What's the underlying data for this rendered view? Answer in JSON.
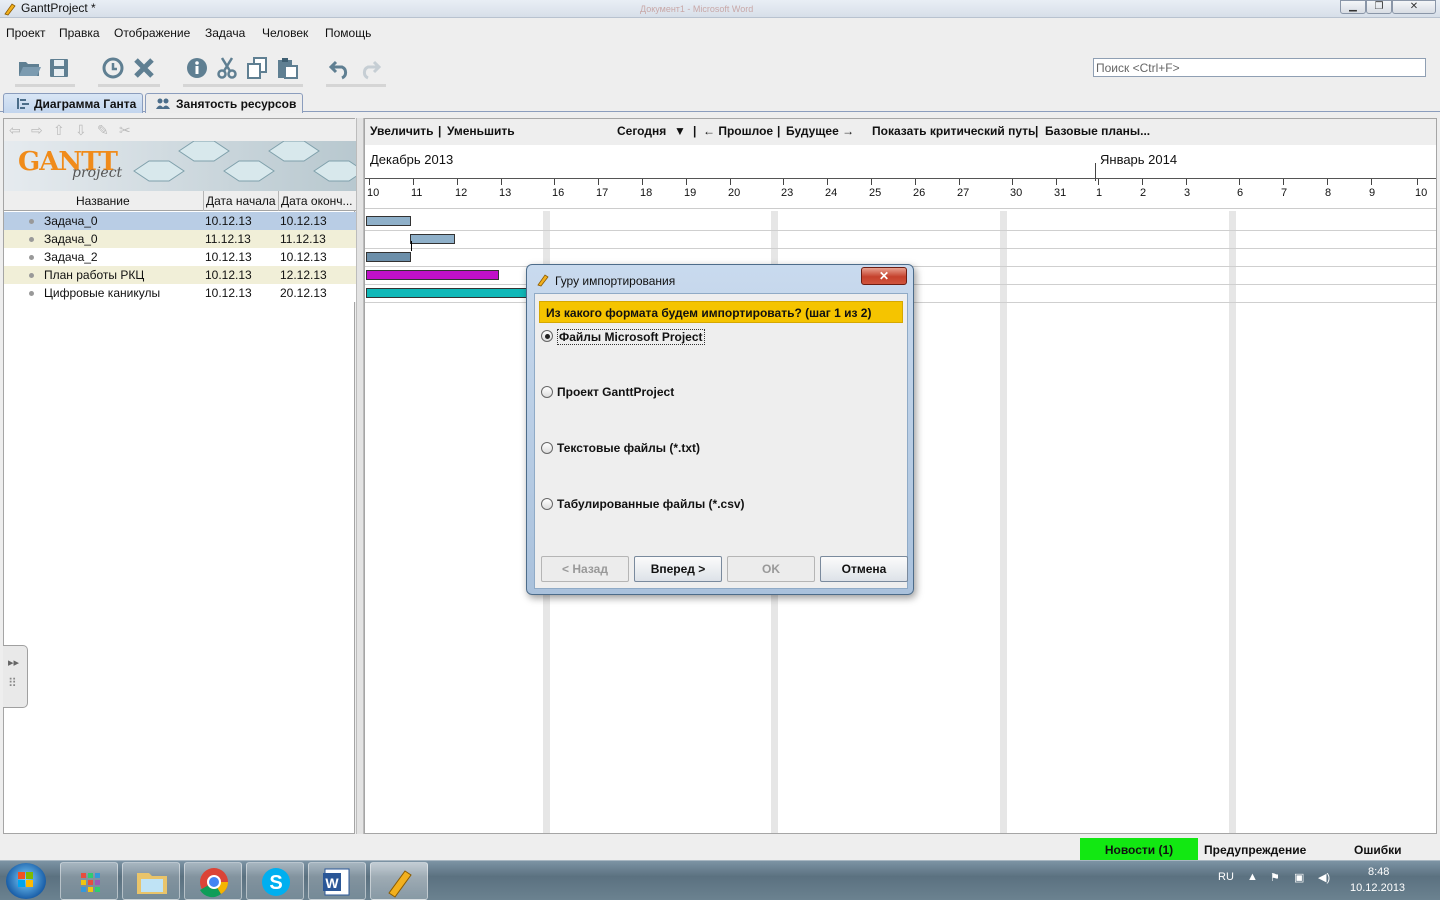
{
  "window": {
    "title": "GanttProject *",
    "background_title": "Документ1 - Microsoft Word"
  },
  "menu": [
    "Проект",
    "Правка",
    "Отображение",
    "Задача",
    "Человек",
    "Помощь"
  ],
  "toolbar": {
    "search_placeholder": "Поиск <Ctrl+F>",
    "icons": [
      "open-icon",
      "save-icon",
      "clock-icon",
      "delete-icon",
      "info-icon",
      "cut-icon",
      "copy-icon",
      "paste-icon",
      "undo-icon",
      "redo-icon"
    ]
  },
  "tabs": [
    {
      "label": "Диаграмма Ганта",
      "active": true
    },
    {
      "label": "Занятость ресурсов",
      "active": false
    }
  ],
  "logo": {
    "text": "GANTT",
    "sub": "project"
  },
  "task_table": {
    "columns": [
      "Название",
      "Дата начала",
      "Дата оконч..."
    ],
    "rows": [
      {
        "name": "Задача_0",
        "start": "10.12.13",
        "end": "10.12.13",
        "selected": true
      },
      {
        "name": "Задача_0",
        "start": "11.12.13",
        "end": "11.12.13",
        "selected": false
      },
      {
        "name": "Задача_2",
        "start": "10.12.13",
        "end": "10.12.13",
        "selected": false
      },
      {
        "name": "План работы РКЦ",
        "start": "10.12.13",
        "end": "12.12.13",
        "selected": false
      },
      {
        "name": "Цифровые каникулы",
        "start": "10.12.13",
        "end": "20.12.13",
        "selected": false
      }
    ]
  },
  "chart": {
    "toolbar": {
      "zoom_in": "Увеличить",
      "zoom_out": "Уменьшить",
      "today": "Сегодня",
      "past": "← Прошлое",
      "future": "Будущее →",
      "critical_path": "Показать критический путь",
      "baselines": "Базовые планы..."
    },
    "months": [
      "Декабрь 2013",
      "Январь 2014"
    ],
    "days": [
      "10",
      "11",
      "12",
      "13",
      "16",
      "17",
      "18",
      "19",
      "20",
      "23",
      "24",
      "25",
      "26",
      "27",
      "30",
      "31",
      "1",
      "2",
      "3",
      "6",
      "7",
      "8",
      "9",
      "10"
    ],
    "bar_colors": [
      "#8fb0c9",
      "#8fb0c9",
      "#6c8faa",
      "#c010c8",
      "#10b8b8"
    ]
  },
  "dialog": {
    "title": "Гуру импортирования",
    "close_label": "✕",
    "question": "Из какого формата будем импортировать? (шаг 1 из 2)",
    "options": [
      {
        "label": "Файлы Microsoft Project",
        "selected": true
      },
      {
        "label": "Проект GanttProject",
        "selected": false
      },
      {
        "label": "Текстовые файлы (*.txt)",
        "selected": false
      },
      {
        "label": "Табулированные файлы (*.csv)",
        "selected": false
      }
    ],
    "buttons": {
      "back": "< Назад",
      "next": "Вперед >",
      "ok": "OK",
      "cancel": "Отмена"
    }
  },
  "statusbar": {
    "news": "Новости (1)",
    "warning": "Предупреждение",
    "errors": "Ошибки",
    "news_color": "#12e812"
  },
  "taskbar": {
    "apps": [
      "start-button",
      "metro-app",
      "explorer",
      "chrome",
      "skype",
      "word",
      "ganttproject"
    ],
    "lang": "RU",
    "time": "8:48",
    "date": "10.12.2013"
  }
}
